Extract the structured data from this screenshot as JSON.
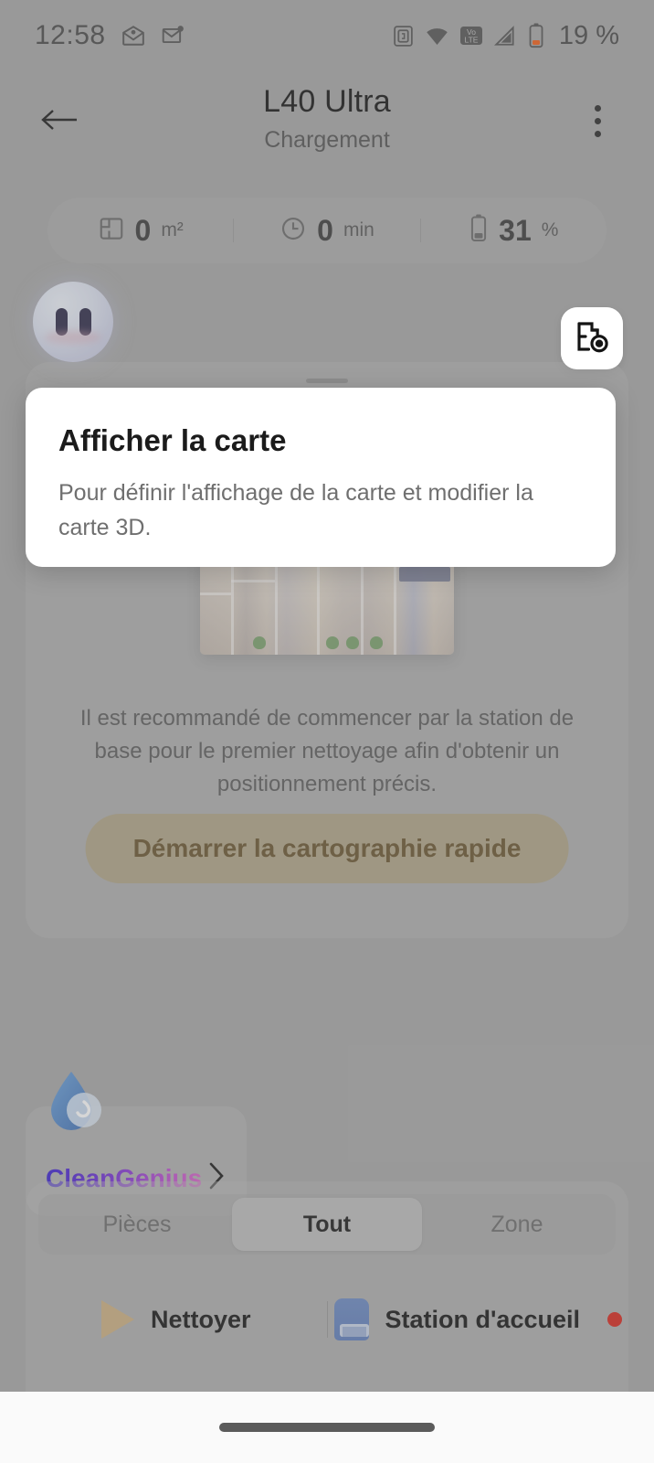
{
  "status_bar": {
    "time": "12:58",
    "battery_text": "19 %",
    "icons": [
      "mail-open-icon",
      "mail-new-icon",
      "nfc-icon",
      "wifi-icon",
      "volte-icon",
      "signal-icon",
      "battery-low-icon"
    ],
    "volte_top": "Vo",
    "volte_bottom": "LTE"
  },
  "header": {
    "title": "L40 Ultra",
    "subtitle": "Chargement",
    "back_icon": "arrow-left-icon",
    "menu_icon": "overflow-menu-icon"
  },
  "stats": [
    {
      "icon": "area-icon",
      "value": "0",
      "unit": "m²"
    },
    {
      "icon": "clock-icon",
      "value": "0",
      "unit": "min"
    },
    {
      "icon": "battery-icon",
      "value": "31",
      "unit": "%"
    }
  ],
  "map_card": {
    "view_map_icon": "map-eye-icon",
    "assistant_icon": "assistant-face-icon",
    "floorplan_alt": "3d-floorplan-preview",
    "hint": "Il est recommandé de commencer par la station de base pour le premier nettoyage afin d'obtenir un positionnement précis.",
    "quick_map_button": "Démarrer la cartographie rapide",
    "quick_map_bg": "#b0a588",
    "quick_map_fg": "#6a5631"
  },
  "clean_genius": {
    "label": "CleanGenius",
    "icon": "water-drop-icon",
    "chevron": "chevron-right-icon",
    "gradient_start": "#3a22d0",
    "gradient_end": "#d965c8"
  },
  "segmented": {
    "options": [
      "Pièces",
      "Tout",
      "Zone"
    ],
    "selected_index": 1
  },
  "actions": [
    {
      "icon": "play-icon",
      "label": "Nettoyer",
      "badge": false
    },
    {
      "icon": "dock-icon",
      "label": "Station d'accueil",
      "badge": true,
      "badge_color": "#d8291f"
    }
  ],
  "coach_mark": {
    "title": "Afficher la carte",
    "description": "Pour définir l'affichage de la carte et modifier la carte 3D.",
    "highlight_icon": "map-eye-icon"
  },
  "nav_bar": {
    "handle": "gesture-pill"
  }
}
